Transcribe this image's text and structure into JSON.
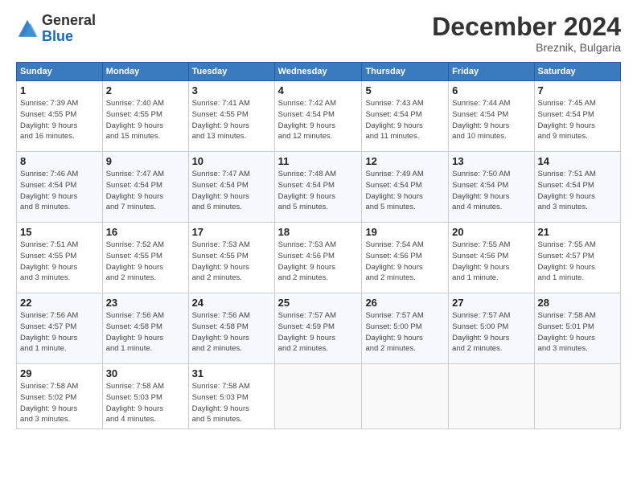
{
  "logo": {
    "general": "General",
    "blue": "Blue"
  },
  "title": "December 2024",
  "location": "Breznik, Bulgaria",
  "headers": [
    "Sunday",
    "Monday",
    "Tuesday",
    "Wednesday",
    "Thursday",
    "Friday",
    "Saturday"
  ],
  "weeks": [
    [
      {
        "day": "1",
        "sunrise": "7:39 AM",
        "sunset": "4:55 PM",
        "daylight": "9 hours and 16 minutes."
      },
      {
        "day": "2",
        "sunrise": "7:40 AM",
        "sunset": "4:55 PM",
        "daylight": "9 hours and 15 minutes."
      },
      {
        "day": "3",
        "sunrise": "7:41 AM",
        "sunset": "4:55 PM",
        "daylight": "9 hours and 13 minutes."
      },
      {
        "day": "4",
        "sunrise": "7:42 AM",
        "sunset": "4:54 PM",
        "daylight": "9 hours and 12 minutes."
      },
      {
        "day": "5",
        "sunrise": "7:43 AM",
        "sunset": "4:54 PM",
        "daylight": "9 hours and 11 minutes."
      },
      {
        "day": "6",
        "sunrise": "7:44 AM",
        "sunset": "4:54 PM",
        "daylight": "9 hours and 10 minutes."
      },
      {
        "day": "7",
        "sunrise": "7:45 AM",
        "sunset": "4:54 PM",
        "daylight": "9 hours and 9 minutes."
      }
    ],
    [
      {
        "day": "8",
        "sunrise": "7:46 AM",
        "sunset": "4:54 PM",
        "daylight": "9 hours and 8 minutes."
      },
      {
        "day": "9",
        "sunrise": "7:47 AM",
        "sunset": "4:54 PM",
        "daylight": "9 hours and 7 minutes."
      },
      {
        "day": "10",
        "sunrise": "7:47 AM",
        "sunset": "4:54 PM",
        "daylight": "9 hours and 6 minutes."
      },
      {
        "day": "11",
        "sunrise": "7:48 AM",
        "sunset": "4:54 PM",
        "daylight": "9 hours and 5 minutes."
      },
      {
        "day": "12",
        "sunrise": "7:49 AM",
        "sunset": "4:54 PM",
        "daylight": "9 hours and 5 minutes."
      },
      {
        "day": "13",
        "sunrise": "7:50 AM",
        "sunset": "4:54 PM",
        "daylight": "9 hours and 4 minutes."
      },
      {
        "day": "14",
        "sunrise": "7:51 AM",
        "sunset": "4:54 PM",
        "daylight": "9 hours and 3 minutes."
      }
    ],
    [
      {
        "day": "15",
        "sunrise": "7:51 AM",
        "sunset": "4:55 PM",
        "daylight": "9 hours and 3 minutes."
      },
      {
        "day": "16",
        "sunrise": "7:52 AM",
        "sunset": "4:55 PM",
        "daylight": "9 hours and 2 minutes."
      },
      {
        "day": "17",
        "sunrise": "7:53 AM",
        "sunset": "4:55 PM",
        "daylight": "9 hours and 2 minutes."
      },
      {
        "day": "18",
        "sunrise": "7:53 AM",
        "sunset": "4:56 PM",
        "daylight": "9 hours and 2 minutes."
      },
      {
        "day": "19",
        "sunrise": "7:54 AM",
        "sunset": "4:56 PM",
        "daylight": "9 hours and 2 minutes."
      },
      {
        "day": "20",
        "sunrise": "7:55 AM",
        "sunset": "4:56 PM",
        "daylight": "9 hours and 1 minute."
      },
      {
        "day": "21",
        "sunrise": "7:55 AM",
        "sunset": "4:57 PM",
        "daylight": "9 hours and 1 minute."
      }
    ],
    [
      {
        "day": "22",
        "sunrise": "7:56 AM",
        "sunset": "4:57 PM",
        "daylight": "9 hours and 1 minute."
      },
      {
        "day": "23",
        "sunrise": "7:56 AM",
        "sunset": "4:58 PM",
        "daylight": "9 hours and 1 minute."
      },
      {
        "day": "24",
        "sunrise": "7:56 AM",
        "sunset": "4:58 PM",
        "daylight": "9 hours and 2 minutes."
      },
      {
        "day": "25",
        "sunrise": "7:57 AM",
        "sunset": "4:59 PM",
        "daylight": "9 hours and 2 minutes."
      },
      {
        "day": "26",
        "sunrise": "7:57 AM",
        "sunset": "5:00 PM",
        "daylight": "9 hours and 2 minutes."
      },
      {
        "day": "27",
        "sunrise": "7:57 AM",
        "sunset": "5:00 PM",
        "daylight": "9 hours and 2 minutes."
      },
      {
        "day": "28",
        "sunrise": "7:58 AM",
        "sunset": "5:01 PM",
        "daylight": "9 hours and 3 minutes."
      }
    ],
    [
      {
        "day": "29",
        "sunrise": "7:58 AM",
        "sunset": "5:02 PM",
        "daylight": "9 hours and 3 minutes."
      },
      {
        "day": "30",
        "sunrise": "7:58 AM",
        "sunset": "5:03 PM",
        "daylight": "9 hours and 4 minutes."
      },
      {
        "day": "31",
        "sunrise": "7:58 AM",
        "sunset": "5:03 PM",
        "daylight": "9 hours and 5 minutes."
      },
      null,
      null,
      null,
      null
    ]
  ]
}
